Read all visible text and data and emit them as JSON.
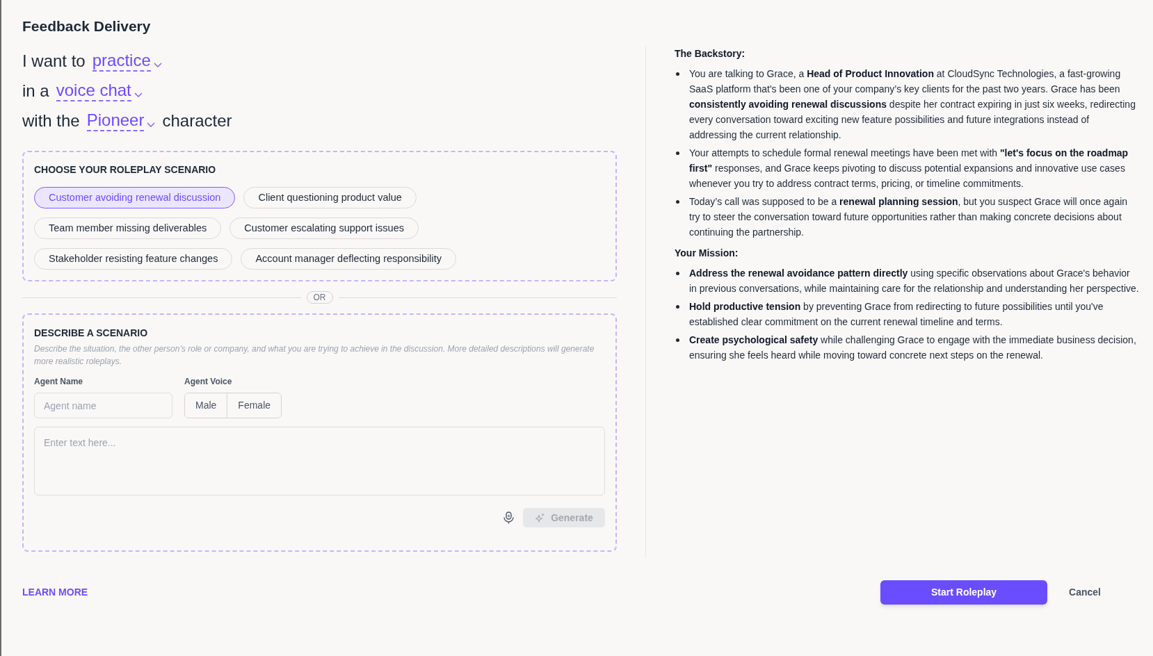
{
  "title": "Feedback Delivery",
  "sentence_lines": [
    {
      "parts": [
        {
          "kind": "text",
          "text": "I want to"
        },
        {
          "kind": "dropdown",
          "text": "practice"
        }
      ]
    },
    {
      "parts": [
        {
          "kind": "text",
          "text": "in a"
        },
        {
          "kind": "dropdown",
          "text": "voice chat"
        }
      ]
    },
    {
      "parts": [
        {
          "kind": "text",
          "text": "with the"
        },
        {
          "kind": "dropdown",
          "text": "Pioneer"
        },
        {
          "kind": "text",
          "text": "character"
        }
      ]
    }
  ],
  "scenario_picker": {
    "heading": "CHOOSE YOUR ROLEPLAY SCENARIO",
    "options": [
      {
        "label": "Customer avoiding renewal discussion",
        "selected": true
      },
      {
        "label": "Client questioning product value",
        "selected": false
      },
      {
        "label": "Team member missing deliverables",
        "selected": false
      },
      {
        "label": "Customer escalating support issues",
        "selected": false
      },
      {
        "label": "Stakeholder resisting feature changes",
        "selected": false
      },
      {
        "label": "Account manager deflecting responsibility",
        "selected": false
      }
    ]
  },
  "divider_label": "OR",
  "describe": {
    "heading": "DESCRIBE A SCENARIO",
    "hint": "Describe the situation, the other person’s role or company, and what you are trying to achieve in the discussion. More detailed descriptions will generate more realistic roleplays.",
    "agent_name": {
      "label": "Agent Name",
      "placeholder": "Agent name"
    },
    "agent_voice": {
      "label": "Agent Voice",
      "options": [
        {
          "label": "Male",
          "selected": false
        },
        {
          "label": "Female",
          "selected": false
        }
      ]
    },
    "description": {
      "placeholder": "Enter text here..."
    },
    "generate_button": {
      "label": "Generate",
      "disabled": true
    }
  },
  "details": [
    {
      "heading": "The Backstory:",
      "bullets": [
        "You are talking to Grace, a **Head of Product Innovation** at CloudSync Technologies, a fast-growing SaaS platform that's been one of your company’s key clients for the past two years. Grace has been **consistently avoiding renewal discussions** despite her contract expiring in just six weeks, redirecting every conversation toward exciting new feature possibilities and future integrations instead of addressing the current relationship.",
        "Your attempts to schedule formal renewal meetings have been met with **\"let's focus on the roadmap first\"** responses, and Grace keeps pivoting to discuss potential expansions and innovative use cases whenever you try to address contract terms, pricing, or timeline commitments.",
        "Today’s call was supposed to be a **renewal planning session**, but you suspect Grace will once again try to steer the conversation toward future opportunities rather than making concrete decisions about continuing the partnership."
      ]
    },
    {
      "heading": "Your Mission:",
      "bullets": [
        "**Address the renewal avoidance pattern directly** using specific observations about Grace's behavior in previous conversations, while maintaining care for the relationship and understanding her perspective.",
        "**Hold productive tension** by preventing Grace from redirecting to future possibilities until you've established clear commitment on the current renewal timeline and terms.",
        "**Create psychological safety** while challenging Grace to engage with the immediate business decision, ensuring she feels heard while moving toward concrete next steps on the renewal."
      ]
    }
  ],
  "footer": {
    "link": "LEARN MORE",
    "primary_button": "Start Roleplay",
    "cancel_button": "Cancel"
  }
}
